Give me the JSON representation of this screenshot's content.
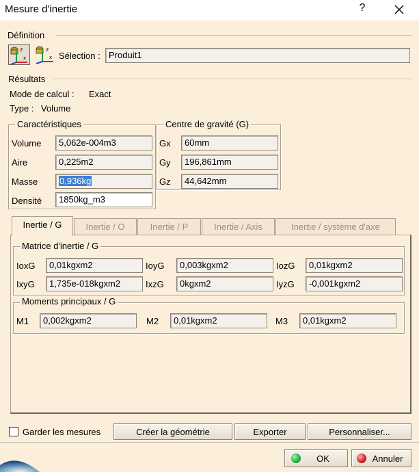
{
  "window": {
    "title": "Mesure d'inertie",
    "help_glyph": "?"
  },
  "definition": {
    "label": "Définition",
    "selection_label": "Sélection :",
    "selection_value": "Produit1"
  },
  "results": {
    "label": "Résultats",
    "mode_label": "Mode de calcul :",
    "mode_value": "Exact",
    "type_label": "Type :",
    "type_value": "Volume"
  },
  "characteristics": {
    "title": "Caractéristiques",
    "rows": [
      {
        "label": "Volume",
        "value": "5,062e-004m3"
      },
      {
        "label": "Aire",
        "value": "0,225m2"
      },
      {
        "label": "Masse",
        "value": "0,936kg"
      },
      {
        "label": "Densité",
        "value": "1850kg_m3"
      }
    ]
  },
  "gravity": {
    "title": "Centre de gravité (G)",
    "rows": [
      {
        "label": "Gx",
        "value": "60mm"
      },
      {
        "label": "Gy",
        "value": "196,861mm"
      },
      {
        "label": "Gz",
        "value": "44,642mm"
      }
    ]
  },
  "tabs": [
    {
      "label": "Inertie / G",
      "active": true
    },
    {
      "label": "Inertie / O",
      "active": false
    },
    {
      "label": "Inertie / P",
      "active": false
    },
    {
      "label": "Inertie / Axis",
      "active": false
    },
    {
      "label": "Inertie / système d'axe",
      "active": false
    }
  ],
  "matrix": {
    "title": "Matrice d'inertie / G",
    "row1": [
      {
        "label": "IoxG",
        "value": "0,01kgxm2"
      },
      {
        "label": "IoyG",
        "value": "0,003kgxm2"
      },
      {
        "label": "IozG",
        "value": "0,01kgxm2"
      }
    ],
    "row2": [
      {
        "label": "IxyG",
        "value": "1,735e-018kgxm2"
      },
      {
        "label": "IxzG",
        "value": "0kgxm2"
      },
      {
        "label": "IyzG",
        "value": "-0,001kgxm2"
      }
    ]
  },
  "moments": {
    "title": "Moments principaux / G",
    "items": [
      {
        "label": "M1",
        "value": "0,002kgxm2"
      },
      {
        "label": "M2",
        "value": "0,01kgxm2"
      },
      {
        "label": "M3",
        "value": "0,01kgxm2"
      }
    ]
  },
  "footer": {
    "keep_label": "Garder les mesures",
    "keep_checked": false,
    "create_label": "Créer la géométrie",
    "export_label": "Exporter",
    "customize_label": "Personnaliser...",
    "ok_label": "OK",
    "cancel_label": "Annuler"
  },
  "colors": {
    "background": "#fbeedb",
    "selection": "#3b7fd6",
    "ok_green": "#2bb24c",
    "cancel_red": "#d8262e"
  }
}
